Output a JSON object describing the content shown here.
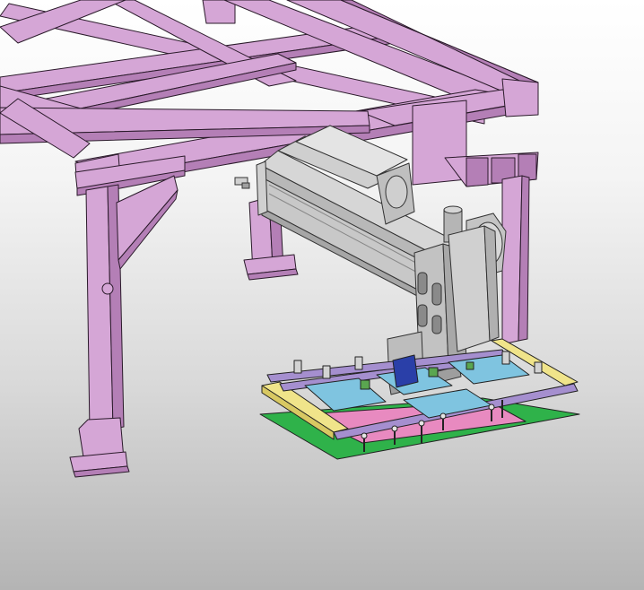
{
  "viewport": {
    "background_top": "#ffffff",
    "background_bottom": "#b4b4b4"
  },
  "scene": {
    "subject": "gantry-robot-with-gripper-fixture",
    "colors": {
      "frame": "#d5a6d6",
      "frame_dark": "#b47fb6",
      "frame_edge": "#2a1a2a",
      "rail": "#c9c9c9",
      "rail_dark": "#9a9a9a",
      "carriage": "#bdbdbd",
      "yellow_bar": "#f0e48a",
      "purple_bar": "#a58fcf",
      "blue_parts": "#7fc4e0",
      "green_base": "#2fb24a",
      "pink_panel": "#e88ac0",
      "motor_blue": "#2a3fa8"
    },
    "icons": [
      "gear-motor-icon",
      "gripper-icon"
    ]
  }
}
